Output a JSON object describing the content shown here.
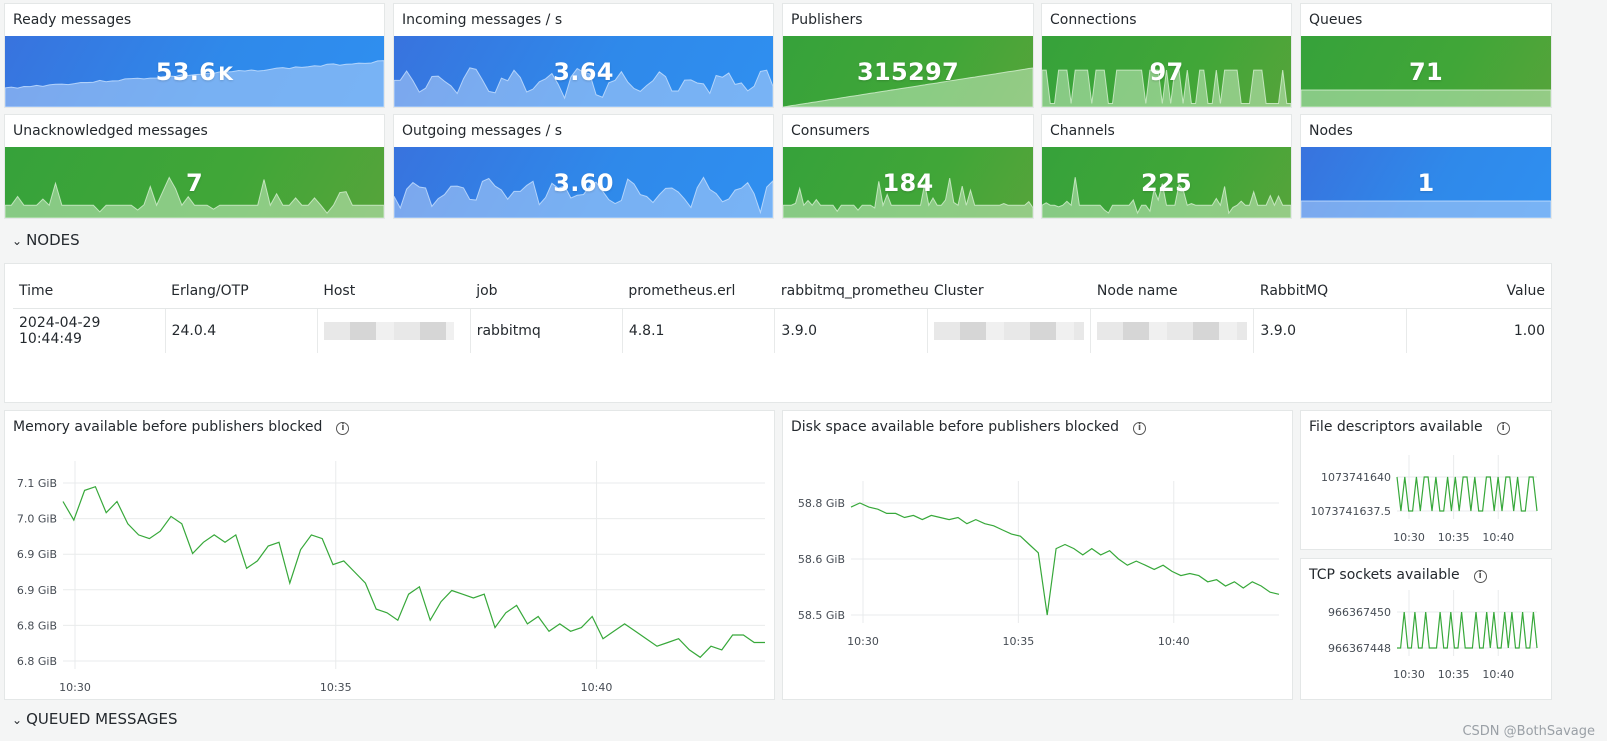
{
  "stats": [
    {
      "title": "Ready messages",
      "value": "53.6",
      "unit": "K",
      "color": "blue",
      "spark": "ramp"
    },
    {
      "title": "Incoming messages / s",
      "value": "3.64",
      "unit": "",
      "color": "blue",
      "spark": "wave"
    },
    {
      "title": "Publishers",
      "value": "315297",
      "unit": "",
      "color": "green",
      "spark": "linear"
    },
    {
      "title": "Connections",
      "value": "97",
      "unit": "",
      "color": "green",
      "spark": "block"
    },
    {
      "title": "Queues",
      "value": "71",
      "unit": "",
      "color": "green",
      "spark": "flat"
    },
    {
      "title": "Unacknowledged messages",
      "value": "7",
      "unit": "",
      "color": "green",
      "spark": "spiky"
    },
    {
      "title": "Outgoing messages / s",
      "value": "3.60",
      "unit": "",
      "color": "blue",
      "spark": "wave"
    },
    {
      "title": "Consumers",
      "value": "184",
      "unit": "",
      "color": "green",
      "spark": "spiky"
    },
    {
      "title": "Channels",
      "value": "225",
      "unit": "",
      "color": "green",
      "spark": "spiky"
    },
    {
      "title": "Nodes",
      "value": "1",
      "unit": "",
      "color": "blue",
      "spark": "flat"
    }
  ],
  "sections": {
    "nodes": "NODES",
    "queued": "QUEUED MESSAGES"
  },
  "nodes_table": {
    "columns": [
      "Time",
      "Erlang/OTP",
      "Host",
      "job",
      "prometheus.erl",
      "rabbitmq_prometheu",
      "Cluster",
      "Node name",
      "RabbitMQ",
      "Value"
    ],
    "row": {
      "time": "2024-04-29 10:44:49",
      "erlang": "24.0.4",
      "job": "rabbitmq",
      "prom": "4.8.1",
      "rmqprom": "3.9.0",
      "rabbitmq": "3.9.0",
      "value": "1.00"
    }
  },
  "graphs": {
    "memory": {
      "title": "Memory available before publishers blocked"
    },
    "disk": {
      "title": "Disk space available before publishers blocked"
    },
    "fd": {
      "title": "File descriptors available"
    },
    "tcp": {
      "title": "TCP sockets available"
    }
  },
  "chart_data": [
    {
      "type": "line",
      "title": "Memory available before publishers blocked",
      "yticks": [
        "7.1 GiB",
        "7.0 GiB",
        "6.9 GiB",
        "6.9 GiB",
        "6.8 GiB",
        "6.8 GiB"
      ],
      "xticks": [
        "10:30",
        "10:35",
        "10:40"
      ],
      "series": [
        {
          "values": [
            7.07,
            7.02,
            7.1,
            7.11,
            7.04,
            7.07,
            7.01,
            6.98,
            6.97,
            6.99,
            7.03,
            7.01,
            6.93,
            6.96,
            6.98,
            6.96,
            6.98,
            6.89,
            6.91,
            6.95,
            6.96,
            6.85,
            6.94,
            6.98,
            6.97,
            6.9,
            6.91,
            6.88,
            6.85,
            6.78,
            6.77,
            6.75,
            6.82,
            6.84,
            6.75,
            6.8,
            6.83,
            6.82,
            6.81,
            6.82,
            6.73,
            6.77,
            6.79,
            6.74,
            6.76,
            6.72,
            6.74,
            6.72,
            6.73,
            6.76,
            6.7,
            6.72,
            6.74,
            6.72,
            6.7,
            6.68,
            6.69,
            6.7,
            6.67,
            6.65,
            6.68,
            6.67,
            6.71,
            6.71,
            6.69,
            6.69
          ]
        }
      ]
    },
    {
      "type": "line",
      "title": "Disk space available before publishers blocked",
      "yticks": [
        "58.8 GiB",
        "58.6 GiB",
        "58.5 GiB"
      ],
      "xticks": [
        "10:30",
        "10:35",
        "10:40"
      ],
      "series": [
        {
          "values": [
            58.88,
            58.9,
            58.88,
            58.87,
            58.85,
            58.85,
            58.83,
            58.84,
            58.82,
            58.84,
            58.83,
            58.82,
            58.83,
            58.8,
            58.82,
            58.8,
            58.79,
            58.77,
            58.75,
            58.74,
            58.7,
            58.66,
            58.36,
            58.68,
            58.7,
            58.68,
            58.65,
            58.68,
            58.65,
            58.67,
            58.63,
            58.6,
            58.62,
            58.6,
            58.58,
            58.6,
            58.57,
            58.55,
            58.56,
            58.55,
            58.52,
            58.53,
            58.5,
            58.52,
            58.49,
            58.52,
            58.5,
            58.47,
            58.46
          ]
        }
      ]
    },
    {
      "type": "line",
      "title": "File descriptors available",
      "yticks": [
        "1073741640",
        "1073741637.5"
      ],
      "xticks": [
        "10:30",
        "10:35",
        "10:40"
      ],
      "series": [
        {
          "values": [
            1,
            0,
            1,
            0,
            0,
            1,
            0,
            1,
            1,
            0,
            1,
            0,
            0,
            1,
            0,
            1,
            0,
            1,
            1,
            0,
            1,
            0,
            0,
            1,
            1,
            0,
            1,
            0,
            1,
            1,
            0,
            1,
            0,
            0,
            1,
            1,
            0
          ]
        }
      ]
    },
    {
      "type": "line",
      "title": "TCP sockets available",
      "yticks": [
        "966367450",
        "966367448"
      ],
      "xticks": [
        "10:30",
        "10:35",
        "10:40"
      ],
      "series": [
        {
          "values": [
            0,
            0,
            1,
            0,
            0,
            1,
            0,
            0,
            1,
            0,
            0,
            0,
            1,
            0,
            0,
            1,
            0,
            0,
            1,
            0,
            0,
            0,
            1,
            0,
            0,
            1,
            0,
            1,
            0,
            0,
            1,
            0,
            1,
            0,
            0,
            1,
            0,
            0,
            1,
            0
          ]
        }
      ]
    }
  ],
  "watermark": "CSDN @BothSavage"
}
